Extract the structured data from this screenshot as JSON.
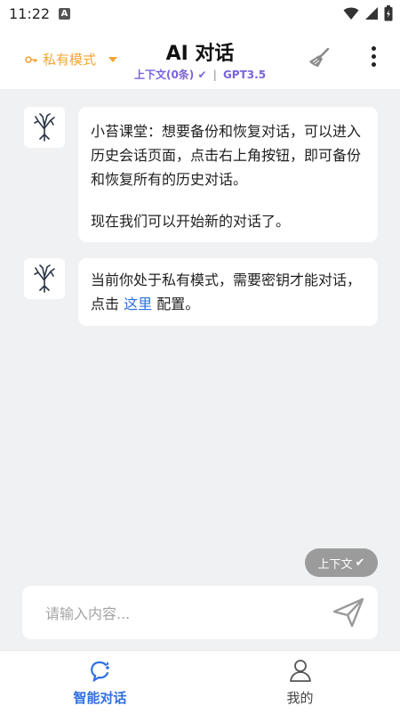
{
  "status_bar": {
    "time": "11:22",
    "notif_icon": "A"
  },
  "header": {
    "mode_label": "私有模式",
    "mode_icon": "key-icon",
    "title": "AI 对话",
    "context_label": "上下文(0条)",
    "check_mark": "✔",
    "separator": "|",
    "model": "GPT3.5",
    "accent": "#f3a534",
    "sub_accent": "#7b63d9"
  },
  "messages": [
    {
      "paragraphs": [
        "小苔课堂：想要备份和恢复对话，可以进入 历史会话页面，点击右上角按钮，即可备份和恢复所有的历史对话。",
        "现在我们可以开始新的对话了。"
      ]
    },
    {
      "text_before": "当前你处于私有模式，需要密钥才能对话，点击 ",
      "link": "这里",
      "text_after": " 配置。"
    }
  ],
  "context_chip": {
    "label": "上下文",
    "check": "✔"
  },
  "input": {
    "placeholder": "请输入内容..."
  },
  "tabs": [
    {
      "label": "智能对话",
      "icon": "chat-icon",
      "active": true
    },
    {
      "label": "我的",
      "icon": "profile-icon",
      "active": false
    }
  ],
  "colors": {
    "link": "#2f6fe0",
    "chip_bg": "#9b9b9b",
    "bg": "#f0f1f3"
  }
}
